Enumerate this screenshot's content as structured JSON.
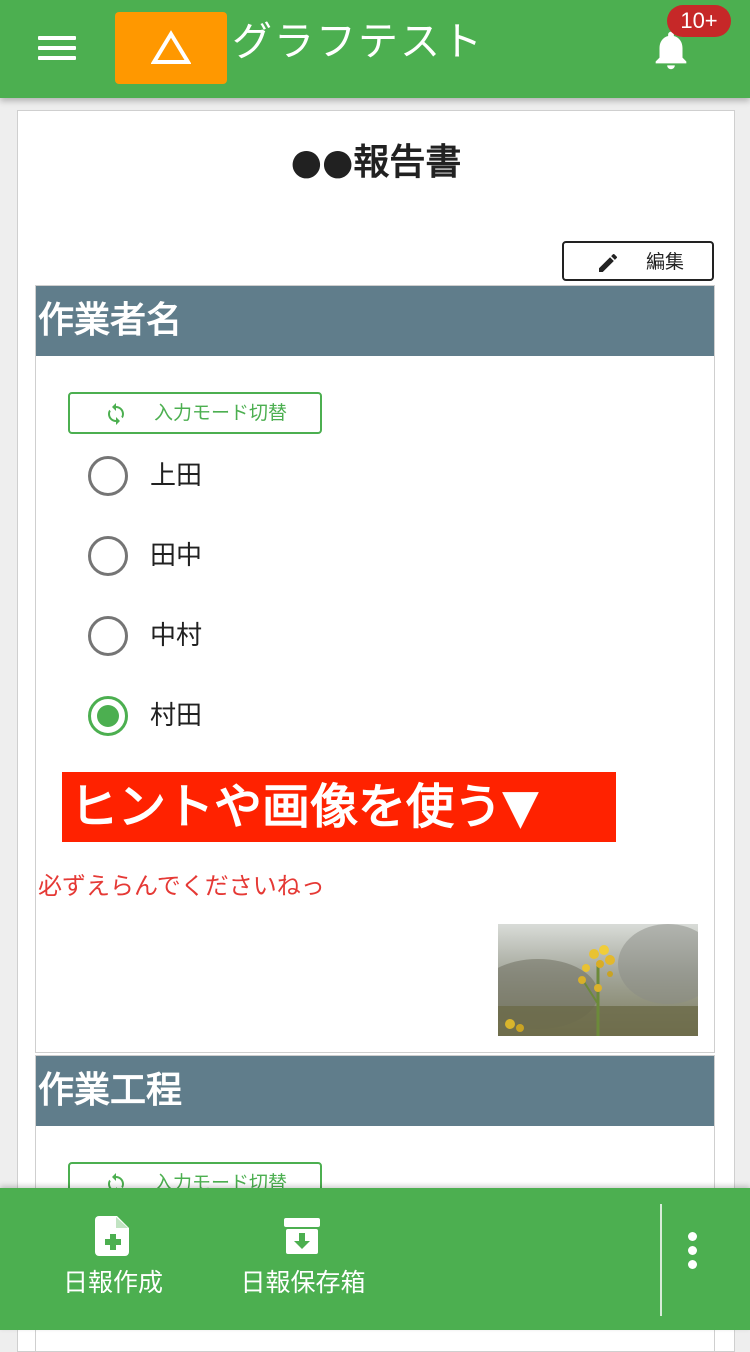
{
  "header": {
    "title": "グラフテスト",
    "notification_badge": "10+",
    "icons": {
      "menu": "hamburger-menu-icon",
      "logo": "triangle-logo-icon",
      "bell": "bell-icon"
    }
  },
  "document": {
    "title": "●●報告書",
    "edit_label": "編集"
  },
  "sections": [
    {
      "header": "作業者名",
      "mode_switch_label": "入力モード切替",
      "options": [
        {
          "label": "上田",
          "selected": false
        },
        {
          "label": "田中",
          "selected": false
        },
        {
          "label": "中村",
          "selected": false
        },
        {
          "label": "村田",
          "selected": true
        }
      ],
      "hint_banner": "ヒントや画像を使う▼",
      "hint_text": "必ずえらんでくださいねっ"
    },
    {
      "header": "作業工程",
      "mode_switch_label": "入力モード切替"
    }
  ],
  "bottom_bar": {
    "items": [
      {
        "label": "日報作成",
        "icon": "file-plus-icon"
      },
      {
        "label": "日報保存箱",
        "icon": "archive-download-icon"
      }
    ],
    "more_icon": "more-vertical-icon"
  },
  "colors": {
    "primary": "#4caf50",
    "accent_orange": "#ff9800",
    "section_header": "#607d8b",
    "hint_banner": "#ff2200",
    "hint_text": "#e53935",
    "badge": "#c62828"
  }
}
